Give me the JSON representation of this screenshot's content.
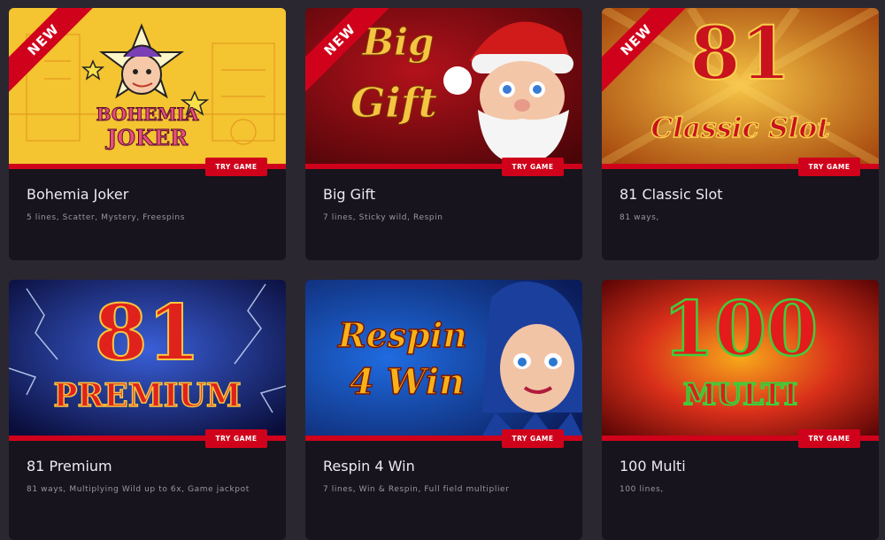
{
  "ribbon_label": "NEW",
  "try_label": "TRY GAME",
  "games": [
    {
      "title": "Bohemia Joker",
      "desc": "5 lines, Scatter, Mystery, Freespins",
      "logo_line1": "BOHEMIA",
      "logo_line2": "JOKER"
    },
    {
      "title": "Big Gift",
      "desc": "7 lines, Sticky wild, Respin",
      "logo_line1": "Big",
      "logo_line2": "Gift"
    },
    {
      "title": "81 Classic Slot",
      "desc": "81 ways,",
      "logo_line1": "81",
      "logo_line2": "Classic Slot"
    },
    {
      "title": "81 Premium",
      "desc": "81 ways, Multiplying Wild up to 6x, Game jackpot",
      "logo_line1": "81",
      "logo_line2": "PREMIUM"
    },
    {
      "title": "Respin 4 Win",
      "desc": "7 lines, Win & Respin, Full field multiplier",
      "logo_line1": "Respin",
      "logo_line2": "4 Win"
    },
    {
      "title": "100 Multi",
      "desc": "100 lines,",
      "logo_line1": "100",
      "logo_line2": "MULTI"
    }
  ],
  "colors": {
    "accent": "#d0021b",
    "card_bg": "#17141d",
    "page_bg": "#2a2730"
  }
}
